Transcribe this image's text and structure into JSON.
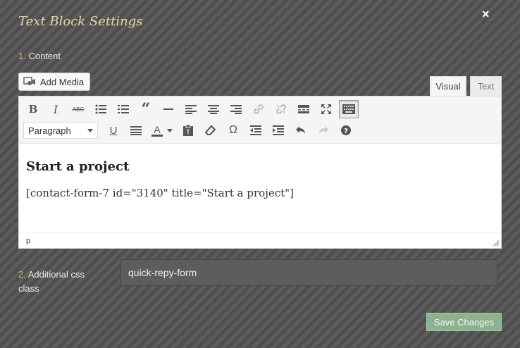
{
  "modal": {
    "title": "Text Block Settings",
    "close_glyph": "×"
  },
  "content_section": {
    "number": "1.",
    "label": "Content"
  },
  "add_media": {
    "label": "Add Media",
    "icon": "media-icon"
  },
  "tabs": [
    {
      "label": "Visual",
      "active": true
    },
    {
      "label": "Text",
      "active": false
    }
  ],
  "toolbar": {
    "row1": [
      "bold-icon",
      "italic-icon",
      "strikethrough-icon",
      "bullet-list-icon",
      "numbered-list-icon",
      "blockquote-icon",
      "horizontal-rule-icon",
      "align-left-icon",
      "align-center-icon",
      "align-right-icon",
      "link-icon",
      "unlink-icon",
      "read-more-icon",
      "fullscreen-icon",
      "toolbar-toggle-icon"
    ],
    "format_select": "Paragraph",
    "row2": [
      "underline-icon",
      "justify-icon",
      "text-color-icon",
      "paste-text-icon",
      "clear-formatting-icon",
      "special-character-icon",
      "outdent-icon",
      "indent-icon",
      "undo-icon",
      "redo-icon",
      "help-icon"
    ],
    "strike_glyph": "ABC",
    "text_color_glyph": "A",
    "omega_glyph": "Ω"
  },
  "editor": {
    "heading": "Start a project",
    "paragraph": "[contact-form-7 id=\"3140\" title=\"Start a project\"]",
    "path": "p"
  },
  "css_section": {
    "number": "2.",
    "label": "Additional css class",
    "value": "quick-repy-form"
  },
  "save_button": {
    "label": "Save Changes",
    "color": "#8cb290"
  },
  "colors": {
    "title": "#e9d7a6",
    "section_number": "#e0b85c"
  }
}
